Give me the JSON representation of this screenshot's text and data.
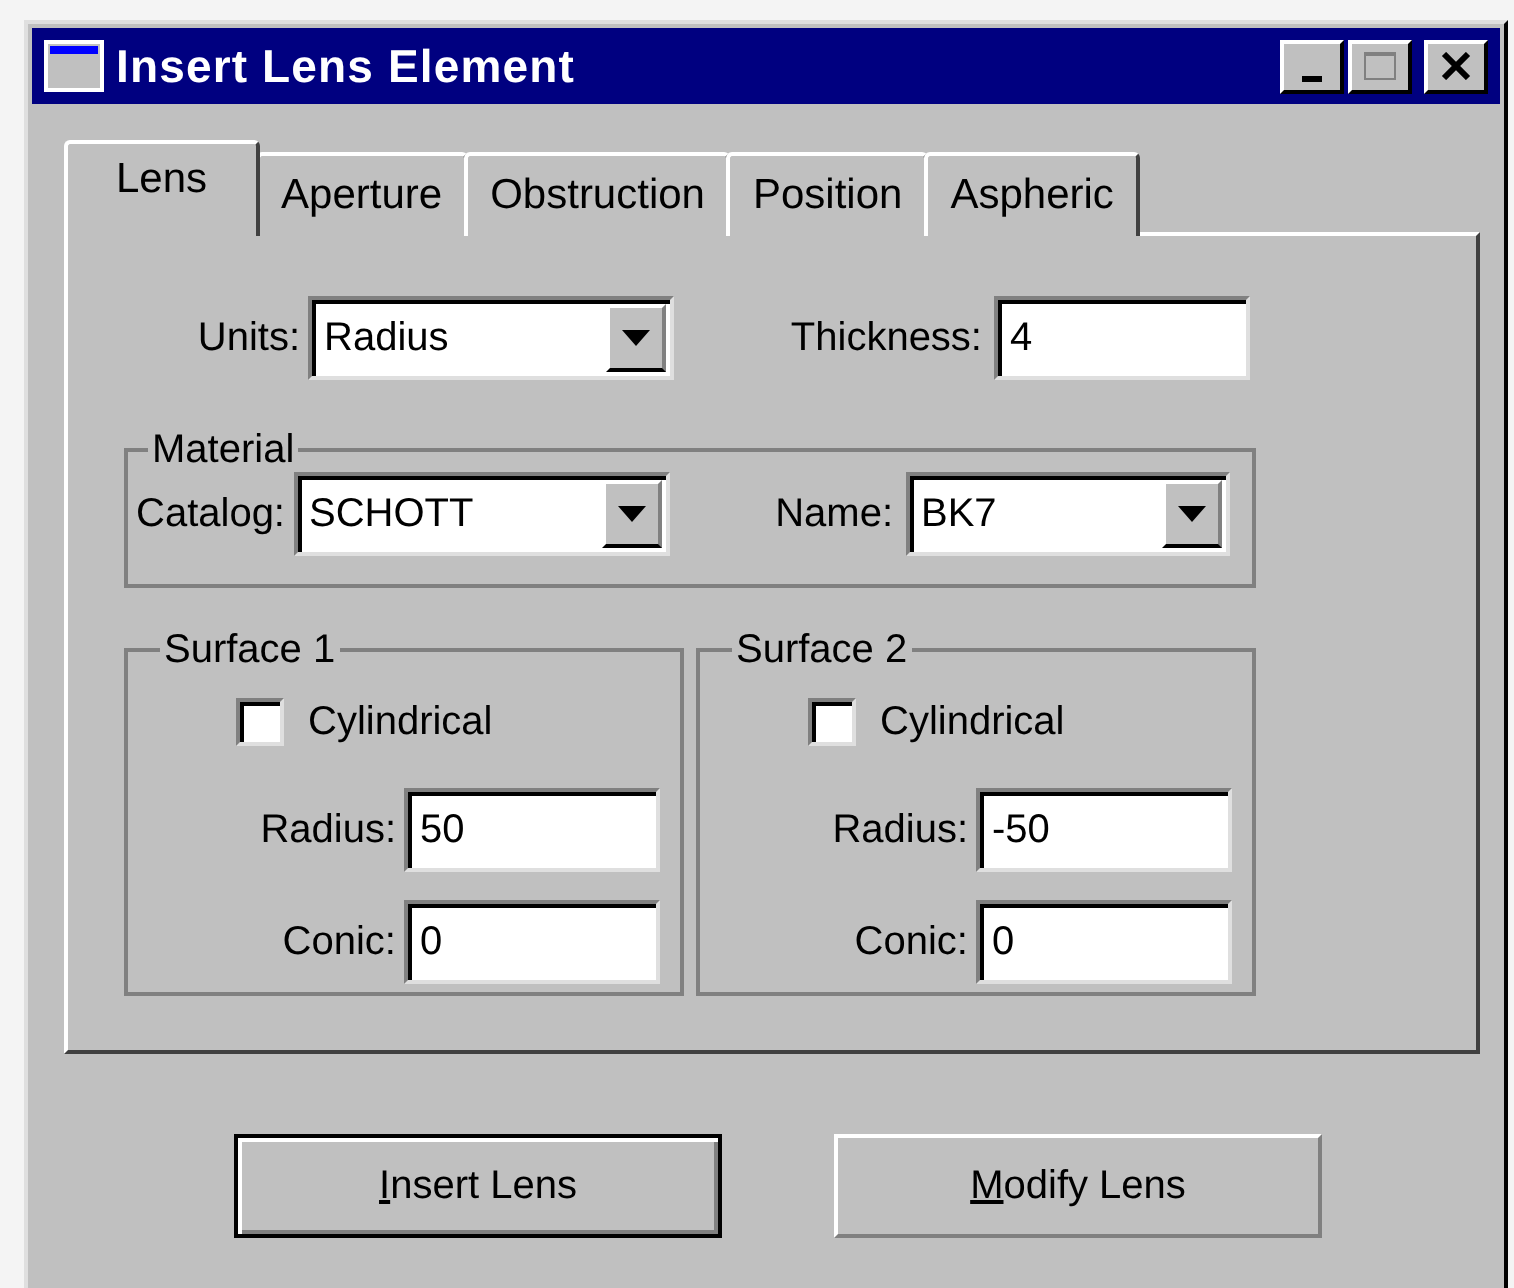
{
  "window": {
    "title": "Insert Lens Element"
  },
  "tabs": [
    {
      "label": "Lens",
      "selected": true
    },
    {
      "label": "Aperture",
      "selected": false
    },
    {
      "label": "Obstruction",
      "selected": false
    },
    {
      "label": "Position",
      "selected": false
    },
    {
      "label": "Aspheric",
      "selected": false
    }
  ],
  "units": {
    "label": "Units:",
    "value": "Radius"
  },
  "thickness": {
    "label": "Thickness:",
    "value": "4"
  },
  "material": {
    "title": "Material",
    "catalog": {
      "label": "Catalog:",
      "value": "SCHOTT"
    },
    "name": {
      "label": "Name:",
      "value": "BK7"
    }
  },
  "surfaces": [
    {
      "title": "Surface 1",
      "cylindrical": {
        "label": "Cylindrical",
        "checked": false
      },
      "radius": {
        "label": "Radius:",
        "value": "50"
      },
      "conic": {
        "label": "Conic:",
        "value": "0"
      }
    },
    {
      "title": "Surface 2",
      "cylindrical": {
        "label": "Cylindrical",
        "checked": false
      },
      "radius": {
        "label": "Radius:",
        "value": "-50"
      },
      "conic": {
        "label": "Conic:",
        "value": "0"
      }
    }
  ],
  "buttons": [
    {
      "mnemonic": "I",
      "rest": "nsert Lens",
      "default": true
    },
    {
      "mnemonic": "M",
      "rest": "odify Lens",
      "default": false
    }
  ]
}
